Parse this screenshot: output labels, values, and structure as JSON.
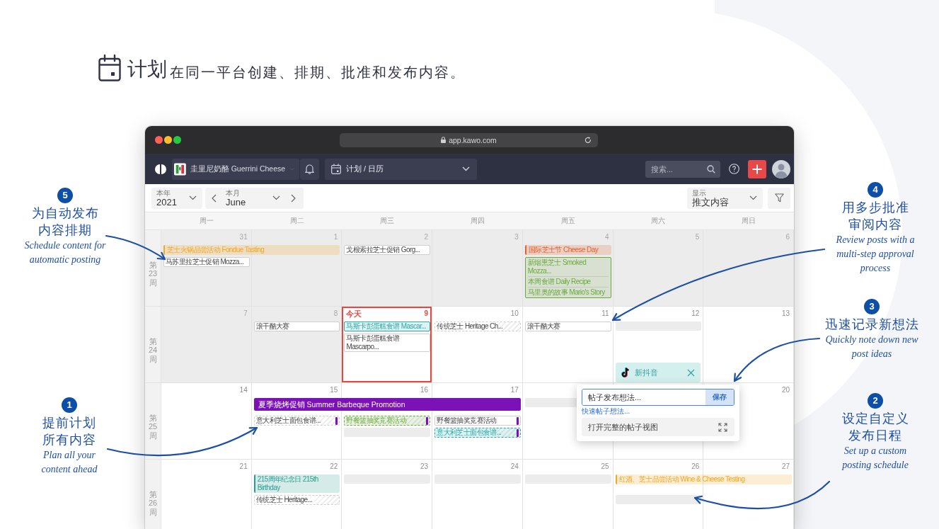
{
  "header": {
    "title": "计划",
    "subtitle": "在同一平台创建、排期、批准和发布内容。"
  },
  "browser": {
    "url": "app.kawo.com"
  },
  "app_bar": {
    "brand": "圭里尼奶酪 Guerrini Cheese",
    "section": "计划 / 日历",
    "search": {
      "placeholder": "搜索..."
    }
  },
  "toolbar": {
    "year": {
      "label": "本年",
      "value": "2021"
    },
    "month": {
      "label": "本月",
      "value": "June"
    },
    "display": {
      "label": "显示",
      "value": "推文内容"
    }
  },
  "calendar": {
    "weekdays": [
      "周一",
      "周二",
      "周三",
      "周四",
      "周五",
      "周六",
      "周日"
    ],
    "weeks": [
      {
        "label": "第23周",
        "days": [
          {
            "date": "31",
            "past": true,
            "today": false,
            "items": [
              {
                "kind": "event",
                "text": "芝士火锅品尝活动 Fondue Tasting",
                "color": "#f5a623"
              },
              {
                "kind": "post",
                "text": "马苏里拉芝士促销 Mozza..."
              }
            ]
          },
          {
            "date": "1",
            "past": true,
            "today": false,
            "items": [
              {
                "kind": "continuation"
              }
            ]
          },
          {
            "date": "2",
            "past": true,
            "today": false,
            "items": [
              {
                "kind": "post",
                "text": "戈根索拉芝士促销 Gorg..."
              }
            ]
          },
          {
            "date": "3",
            "past": true,
            "today": false
          },
          {
            "date": "4",
            "past": true,
            "today": false,
            "items": [
              {
                "kind": "event",
                "text": "国际芝士节 Cheese Day",
                "color": "#e8602c"
              },
              {
                "kind": "group",
                "color": "#6aaa3a",
                "entries": [
                  "新烟熏芝士 Smoked Mozza...",
                  "本周食谱 Daily Recipe",
                  "马里奥的故事 Mario's Story"
                ]
              }
            ]
          },
          {
            "date": "5",
            "past": true,
            "today": false
          },
          {
            "date": "6",
            "past": true,
            "today": false
          }
        ]
      },
      {
        "label": "第24周",
        "days": [
          {
            "date": "7",
            "past": true,
            "today": false
          },
          {
            "date": "8",
            "past": true,
            "today": false,
            "items": [
              {
                "kind": "post",
                "text": "滚干酪大赛"
              }
            ]
          },
          {
            "date": "9",
            "past": false,
            "today": true,
            "today_label": "今天",
            "items": [
              {
                "kind": "post",
                "text": "马斯卡彭蛋糕食谱 Mascar...",
                "color": "#2aa7a7"
              },
              {
                "kind": "post",
                "text": "马斯卡彭蛋糕食谱 Mascarpo..."
              }
            ]
          },
          {
            "date": "10",
            "past": false,
            "today": false,
            "items": [
              {
                "kind": "draft",
                "text": "传统芝士 Heritage Ch..."
              }
            ]
          },
          {
            "date": "11",
            "past": false,
            "today": false,
            "items": [
              {
                "kind": "post",
                "text": "滚干酪大赛"
              }
            ]
          },
          {
            "date": "12",
            "past": false,
            "today": false,
            "items": [
              {
                "kind": "slot"
              }
            ]
          },
          {
            "date": "13",
            "past": false,
            "today": false
          }
        ]
      },
      {
        "label": "第25周",
        "days": [
          {
            "date": "14",
            "past": false,
            "today": false
          },
          {
            "date": "15",
            "past": false,
            "today": false,
            "items": [
              {
                "kind": "campaign",
                "text": "夏季烧烤促销 Summer Barbeque Promotion",
                "color": "#7a12b8"
              },
              {
                "kind": "draft",
                "text": "意大利芝士面包食谱...",
                "marker": {
                  "color": "#7a12b8"
                }
              }
            ]
          },
          {
            "date": "16",
            "past": false,
            "today": false,
            "items": [
              {
                "kind": "continuation"
              },
              {
                "kind": "draft",
                "text": "野餐篮抽奖竞赛活动",
                "color": "#6aaa3a",
                "marker": {
                  "color": "#7a12b8"
                }
              },
              {
                "kind": "slot"
              }
            ]
          },
          {
            "date": "17",
            "past": false,
            "today": false,
            "items": [
              {
                "kind": "continuation"
              },
              {
                "kind": "post",
                "text": "野餐篮抽奖竞赛活动",
                "marker": {
                  "color": "#7a12b8"
                }
              },
              {
                "kind": "draft",
                "text": "意大利芝士面包食谱...",
                "color": "#2aa7a7",
                "marker": {
                  "color": "#7a12b8"
                }
              }
            ]
          },
          {
            "past": false,
            "today": false,
            "items": [
              {
                "kind": "slot"
              }
            ]
          },
          {
            "past": false,
            "today": false
          },
          {
            "date": "20",
            "past": false,
            "today": false
          }
        ]
      },
      {
        "label": "第26周",
        "days": [
          {
            "date": "21",
            "past": false,
            "today": false
          },
          {
            "date": "22",
            "past": false,
            "today": false,
            "items": [
              {
                "kind": "event",
                "text": "215周年纪念日 215th Birthday",
                "color": "#2a9d8f"
              },
              {
                "kind": "draft",
                "text": "传统芝士 Heritage..."
              }
            ]
          },
          {
            "date": "23",
            "past": false,
            "today": false,
            "items": [
              {
                "kind": "slot"
              }
            ]
          },
          {
            "date": "24",
            "past": false,
            "today": false,
            "items": [
              {
                "kind": "slot"
              }
            ]
          },
          {
            "date": "25",
            "past": false,
            "today": false,
            "items": [
              {
                "kind": "slot"
              }
            ]
          },
          {
            "date": "26",
            "past": false,
            "today": false,
            "items": [
              {
                "kind": "event",
                "text": "红酒、芝士品尝活动 Wine & Cheese Testing",
                "color": "#f5a623"
              },
              {
                "kind": "slot"
              }
            ]
          },
          {
            "date": "27",
            "past": false,
            "today": false,
            "items": [
              {
                "kind": "continuation"
              }
            ]
          }
        ]
      }
    ]
  },
  "new_post": {
    "network": "新抖音",
    "idea_field": {
      "placeholder": "帖子发布想法..."
    },
    "save_button": "保存",
    "quick_link": "快速帖子想法...",
    "open_full_view": "打开完整的帖子视图"
  },
  "annotations": [
    {
      "number": "5",
      "title": "为自动发布内容排期",
      "caption": "Schedule content for automatic posting"
    },
    {
      "number": "1",
      "title": "提前计划所有内容",
      "caption": "Plan all your content ahead"
    },
    {
      "number": "4",
      "title": "用多步批准审阅内容",
      "caption": "Review posts with a multi-step approval process"
    },
    {
      "number": "3",
      "title": "迅速记录新想法",
      "caption": "Quickly note down new post ideas"
    },
    {
      "number": "2",
      "title": "设定自定义发布日程",
      "caption": "Set up a custom posting schedule"
    }
  ]
}
